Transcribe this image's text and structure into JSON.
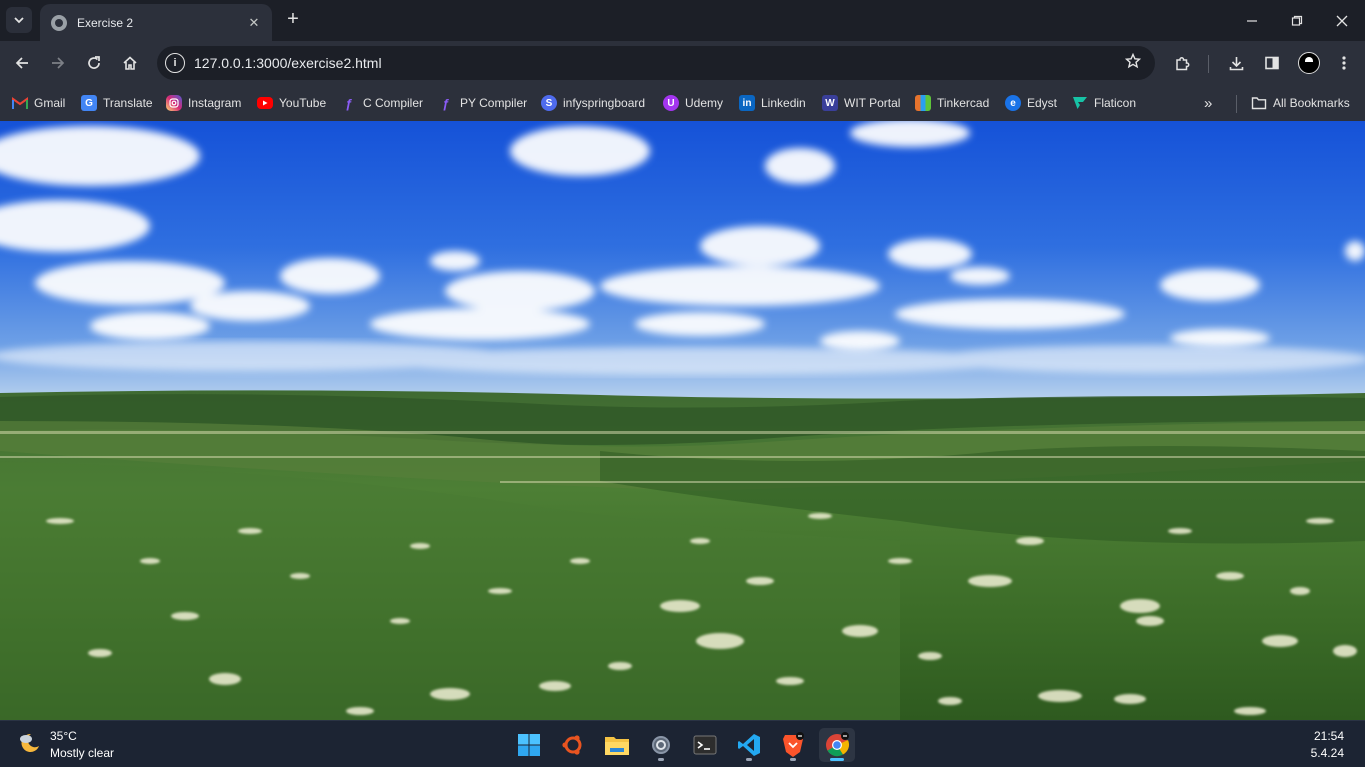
{
  "tabstrip": {
    "tab_title": "Exercise 2",
    "tab_menu_icon": "chevron-down-icon",
    "new_tab_label": "+",
    "window_controls": [
      "minimize",
      "restore",
      "close"
    ]
  },
  "toolbar": {
    "url": "127.0.0.1:3000/exercise2.html"
  },
  "bookmarks": {
    "items": [
      {
        "label": "Gmail",
        "icon": "gmail-icon",
        "color": "#ea4335"
      },
      {
        "label": "Translate",
        "icon": "translate-icon",
        "color": "#4285f4"
      },
      {
        "label": "Instagram",
        "icon": "instagram-icon",
        "color": "#d62976"
      },
      {
        "label": "YouTube",
        "icon": "youtube-icon",
        "color": "#ff0000"
      },
      {
        "label": "C Compiler",
        "icon": "c-compiler-icon",
        "color": "#7b3fe4"
      },
      {
        "label": "PY Compiler",
        "icon": "py-compiler-icon",
        "color": "#7b3fe4"
      },
      {
        "label": "infyspringboard",
        "icon": "infyspringboard-icon",
        "color": "#4f6bed"
      },
      {
        "label": "Udemy",
        "icon": "udemy-icon",
        "color": "#a435f0"
      },
      {
        "label": "Linkedin",
        "icon": "linkedin-icon",
        "color": "#0a66c2"
      },
      {
        "label": "WIT Portal",
        "icon": "wit-portal-icon",
        "color": "#3a3f9a"
      },
      {
        "label": "Tinkercad",
        "icon": "tinkercad-icon",
        "color": "#e6732d"
      },
      {
        "label": "Edyst",
        "icon": "edyst-icon",
        "color": "#1a73e8"
      },
      {
        "label": "Flaticon",
        "icon": "flaticon-icon",
        "color": "#17c3a6"
      }
    ],
    "all_bookmarks_label": "All Bookmarks"
  },
  "taskbar": {
    "weather_temp": "35°C",
    "weather_desc": "Mostly clear",
    "time": "21:54",
    "date": "5.4.24",
    "apps": [
      "windows-start-icon",
      "ubuntu-icon",
      "file-explorer-icon",
      "settings-icon",
      "terminal-icon",
      "vscode-icon",
      "brave-icon",
      "chrome-icon"
    ]
  }
}
